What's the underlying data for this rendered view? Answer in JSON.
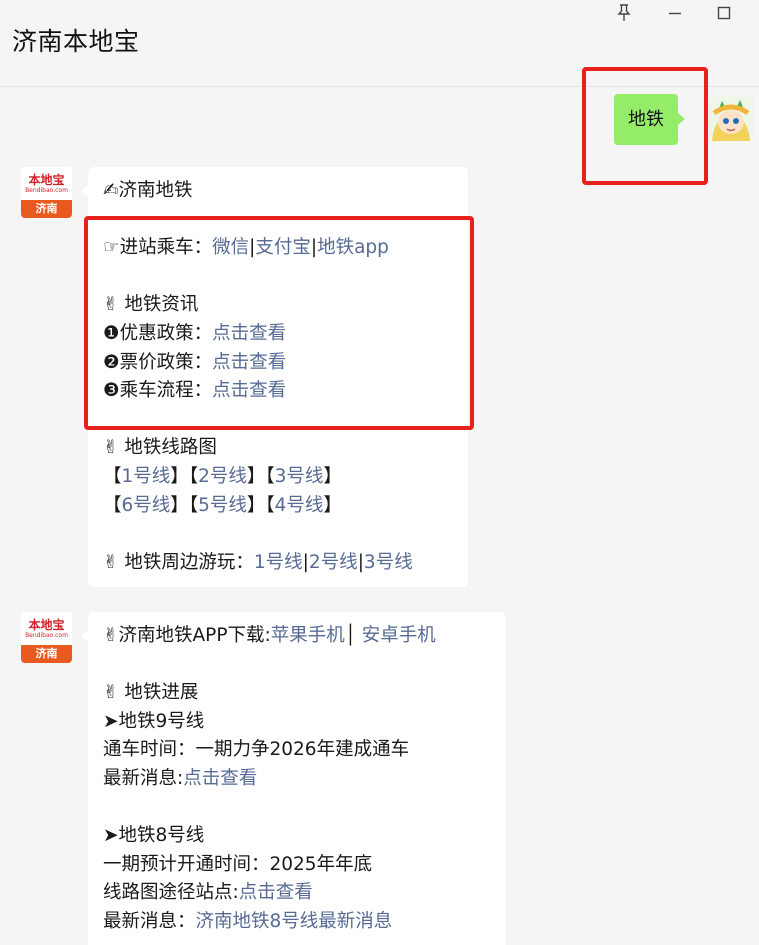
{
  "window": {
    "title": "济南本地宝",
    "controls": {
      "pin": "pin-icon",
      "minimize": "minimize-icon",
      "maximize": "maximize-icon"
    }
  },
  "user_message": {
    "text": "地铁"
  },
  "sender_avatar": {
    "logo_text": "本地宝",
    "logo_sub": "Bendibao.com",
    "city": "济南"
  },
  "message1": {
    "title": "✍济南地铁",
    "entry": {
      "label": "☞进站乘车：",
      "links": [
        "微信",
        "支付宝",
        "地铁app"
      ],
      "sep": "|"
    },
    "news_heading": "✌ 地铁资讯",
    "news_items": [
      {
        "label": "❶优惠政策：",
        "link": "点击查看"
      },
      {
        "label": "❷票价政策：",
        "link": "点击查看"
      },
      {
        "label": "❸乘车流程：",
        "link": "点击查看"
      }
    ],
    "map_heading": "✌ 地铁线路图",
    "lines_row1": [
      "1号线",
      "2号线",
      "3号线"
    ],
    "lines_row2": [
      "6号线",
      "5号线",
      "4号线"
    ],
    "bracket_open": "【",
    "bracket_close": "】",
    "tour": {
      "label": "✌ 地铁周边游玩：",
      "links": [
        "1号线",
        "2号线",
        "3号线"
      ],
      "sep": "|"
    }
  },
  "message2": {
    "app": {
      "label": "✌济南地铁APP下载:",
      "link_ios": "苹果手机",
      "sep": "│ ",
      "link_android": "安卓手机"
    },
    "progress_heading": "✌ 地铁进展",
    "line9": {
      "heading": "➤地铁9号线",
      "open_label": "通车时间：一期力争2026年建成通车",
      "news_label": "最新消息:",
      "news_link": "点击查看"
    },
    "line8": {
      "heading": "➤地铁8号线",
      "open_label": "一期预计开通时间：2025年年底",
      "map_label": "线路图途径站点:",
      "map_link": "点击查看",
      "news_label": "最新消息：",
      "news_link": "济南地铁8号线最新消息"
    }
  },
  "colors": {
    "link": "#576b95",
    "outgoing_bubble": "#95ec69",
    "highlight_box": "#e8211c",
    "city_badge": "#e85a20"
  }
}
